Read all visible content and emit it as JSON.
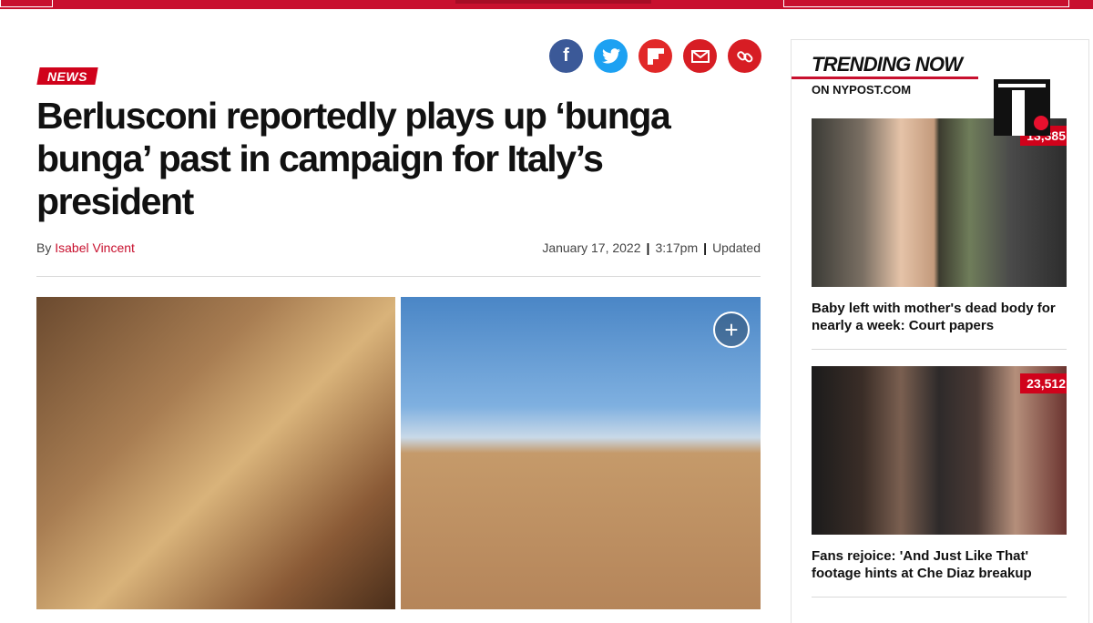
{
  "article": {
    "category": "NEWS",
    "headline": "Berlusconi reportedly plays up ‘bunga bunga’ past in campaign for Italy’s president",
    "byline_prefix": "By",
    "author": "Isabel Vincent",
    "date": "January 17, 2022",
    "time": "3:17pm",
    "updated_label": "Updated",
    "expand_symbol": "+"
  },
  "share": {
    "icons": [
      "facebook-icon",
      "twitter-icon",
      "flipboard-icon",
      "email-icon",
      "link-icon"
    ],
    "glyphs": {
      "facebook": "f",
      "twitter": "t",
      "flipboard": "F",
      "email": "✉",
      "link": "🔗"
    }
  },
  "sidebar": {
    "title": "TRENDING NOW",
    "subtitle": "ON NYPOST.COM",
    "cards": [
      {
        "count": "13,385",
        "title": "Baby left with mother's dead body for nearly a week: Court papers"
      },
      {
        "count": "23,512",
        "title": "Fans rejoice: 'And Just Like That' footage hints at Che Diaz breakup"
      }
    ]
  },
  "colors": {
    "brand_red": "#c8102e",
    "facebook": "#3b5998",
    "twitter": "#1da1f2",
    "flipboard": "#e12828",
    "email": "#d71d24"
  }
}
